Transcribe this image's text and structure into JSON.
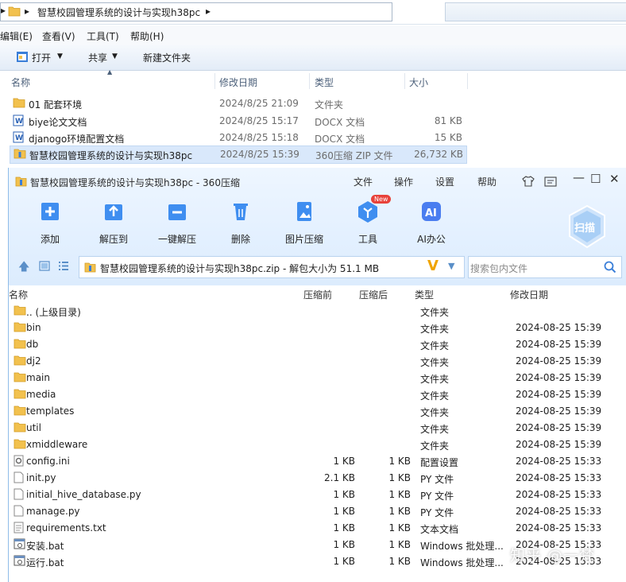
{
  "explorer": {
    "breadcrumb": "智慧校园管理系统的设计与实现h38pc",
    "menu": [
      "编辑(E)",
      "查看(V)",
      "工具(T)",
      "帮助(H)"
    ],
    "toolbar": {
      "open": "打开",
      "share": "共享",
      "new_folder": "新建文件夹"
    },
    "columns": {
      "name": "名称",
      "date": "修改日期",
      "type": "类型",
      "size": "大小"
    },
    "rows": [
      {
        "name": "01 配套环境",
        "date": "2024/8/25 21:09",
        "type": "文件夹",
        "size": "",
        "icon": "folder-icon"
      },
      {
        "name": "biye论文文档",
        "date": "2024/8/25 15:17",
        "type": "DOCX 文档",
        "size": "81 KB",
        "icon": "word-doc-icon"
      },
      {
        "name": "djanogo环境配置文档",
        "date": "2024/8/25 15:18",
        "type": "DOCX 文档",
        "size": "15 KB",
        "icon": "word-doc-icon"
      },
      {
        "name": "智慧校园管理系统的设计与实现h38pc",
        "date": "2024/8/25 15:39",
        "type": "360压缩 ZIP 文件",
        "size": "26,732 KB",
        "icon": "zip-archive-icon"
      }
    ]
  },
  "zip": {
    "title": "智慧校园管理系统的设计与实现h38pc - 360压缩",
    "menu": [
      "文件",
      "操作",
      "设置",
      "帮助"
    ],
    "tools": [
      {
        "label": "添加",
        "icon": "add-icon"
      },
      {
        "label": "解压到",
        "icon": "extract-to-icon"
      },
      {
        "label": "一键解压",
        "icon": "one-click-extract-icon"
      },
      {
        "label": "删除",
        "icon": "delete-icon"
      },
      {
        "label": "图片压缩",
        "icon": "image-compress-icon"
      },
      {
        "label": "工具",
        "icon": "tools-icon",
        "badge": "New"
      },
      {
        "label": "AI办公",
        "icon": "ai-office-icon"
      }
    ],
    "scan_label": "扫描",
    "path": "智慧校园管理系统的设计与实现h38pc.zip - 解包大小为 51.1 MB",
    "search_placeholder": "搜索包内文件",
    "columns": {
      "name": "名称",
      "packed": "压缩前",
      "unpacked": "压缩后",
      "type": "类型",
      "date": "修改日期"
    },
    "rows": [
      {
        "name": ".. (上级目录)",
        "packed": "",
        "unpacked": "",
        "type": "文件夹",
        "date": "",
        "icon": "folder-icon"
      },
      {
        "name": "bin",
        "packed": "",
        "unpacked": "",
        "type": "文件夹",
        "date": "2024-08-25 15:39",
        "icon": "folder-icon"
      },
      {
        "name": "db",
        "packed": "",
        "unpacked": "",
        "type": "文件夹",
        "date": "2024-08-25 15:39",
        "icon": "folder-icon"
      },
      {
        "name": "dj2",
        "packed": "",
        "unpacked": "",
        "type": "文件夹",
        "date": "2024-08-25 15:39",
        "icon": "folder-icon"
      },
      {
        "name": "main",
        "packed": "",
        "unpacked": "",
        "type": "文件夹",
        "date": "2024-08-25 15:39",
        "icon": "folder-icon"
      },
      {
        "name": "media",
        "packed": "",
        "unpacked": "",
        "type": "文件夹",
        "date": "2024-08-25 15:39",
        "icon": "folder-icon"
      },
      {
        "name": "templates",
        "packed": "",
        "unpacked": "",
        "type": "文件夹",
        "date": "2024-08-25 15:39",
        "icon": "folder-icon"
      },
      {
        "name": "util",
        "packed": "",
        "unpacked": "",
        "type": "文件夹",
        "date": "2024-08-25 15:39",
        "icon": "folder-icon"
      },
      {
        "name": "xmiddleware",
        "packed": "",
        "unpacked": "",
        "type": "文件夹",
        "date": "2024-08-25 15:39",
        "icon": "folder-icon"
      },
      {
        "name": "config.ini",
        "packed": "1 KB",
        "unpacked": "1 KB",
        "type": "配置设置",
        "date": "2024-08-25 15:33",
        "icon": "config-file-icon"
      },
      {
        "name": "init.py",
        "packed": "2.1 KB",
        "unpacked": "1 KB",
        "type": "PY 文件",
        "date": "2024-08-25 15:33",
        "icon": "file-icon"
      },
      {
        "name": "initial_hive_database.py",
        "packed": "1 KB",
        "unpacked": "1 KB",
        "type": "PY 文件",
        "date": "2024-08-25 15:33",
        "icon": "file-icon"
      },
      {
        "name": "manage.py",
        "packed": "1 KB",
        "unpacked": "1 KB",
        "type": "PY 文件",
        "date": "2024-08-25 15:33",
        "icon": "file-icon"
      },
      {
        "name": "requirements.txt",
        "packed": "1 KB",
        "unpacked": "1 KB",
        "type": "文本文档",
        "date": "2024-08-25 15:33",
        "icon": "text-file-icon"
      },
      {
        "name": "安装.bat",
        "packed": "1 KB",
        "unpacked": "1 KB",
        "type": "Windows 批处理...",
        "date": "2024-08-25 15:33",
        "icon": "batch-file-icon"
      },
      {
        "name": "运行.bat",
        "packed": "1 KB",
        "unpacked": "1 KB",
        "type": "Windows 批处理...",
        "date": "2024-08-25 15:33",
        "icon": "batch-file-icon"
      }
    ]
  },
  "watermark": "知乎 @一梵",
  "colors": {
    "accent": "#1e88e5",
    "folder": "#f2c14e",
    "selection": "#d9e8fb",
    "toolbar_bg": "#e3f0ff"
  }
}
